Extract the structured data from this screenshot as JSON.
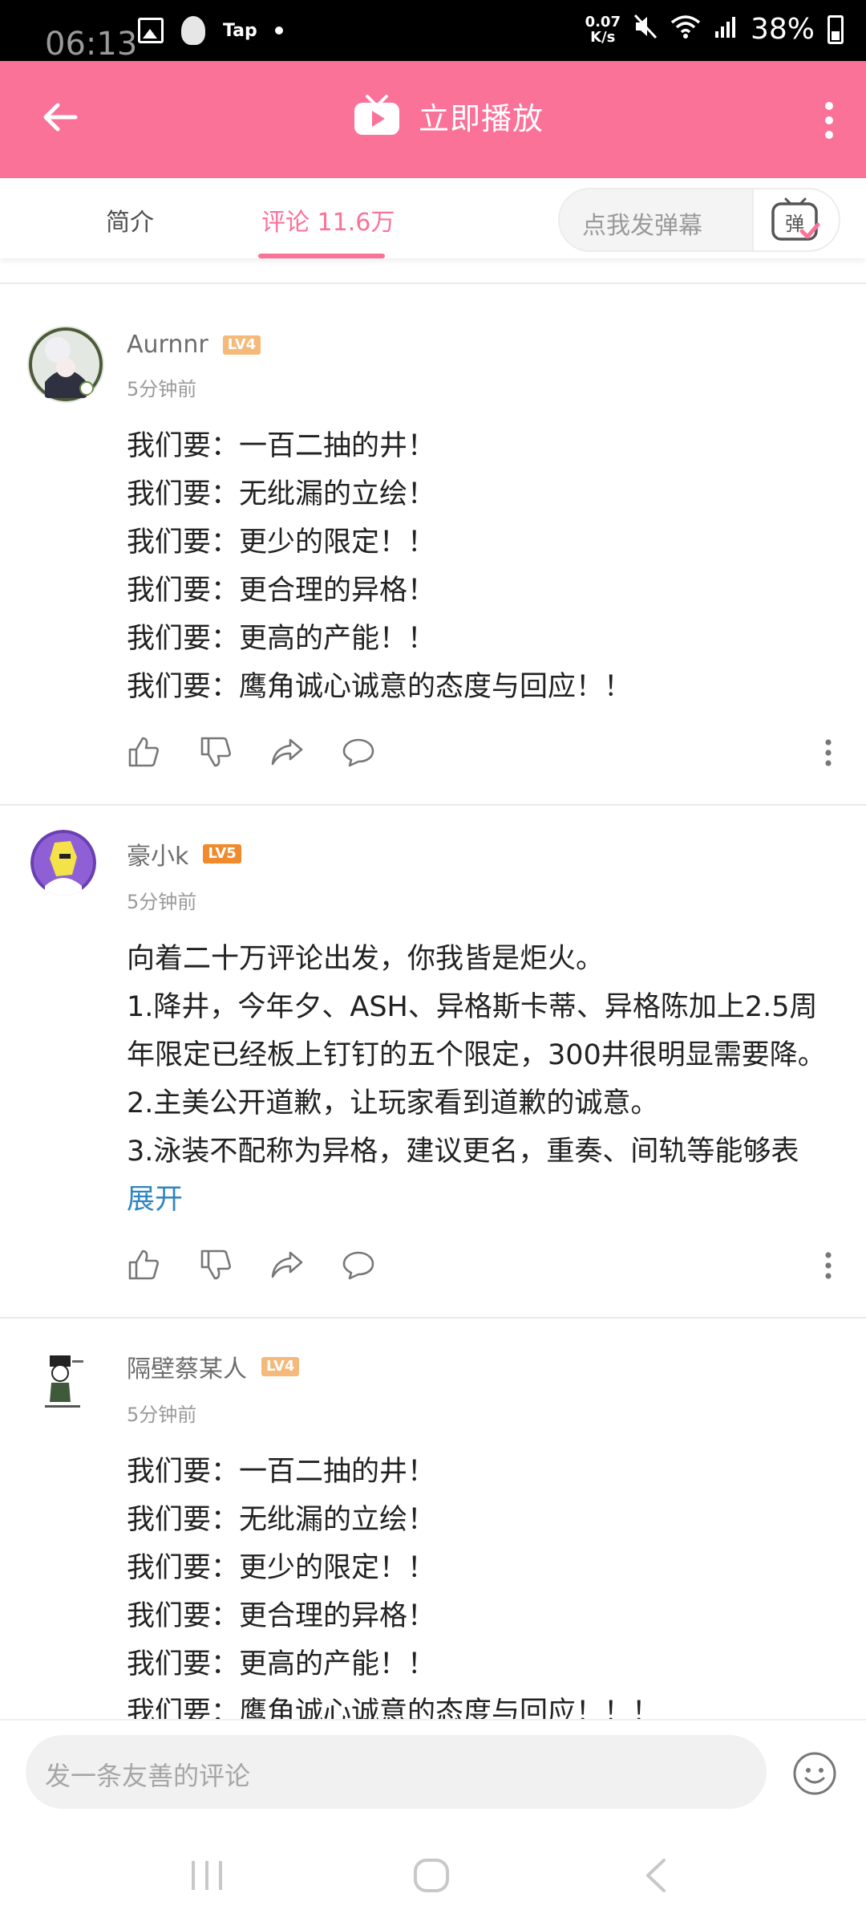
{
  "status_bar": {
    "time": "06:13",
    "tap_label": "Tap",
    "speed_value": "0.07",
    "speed_unit": "K/s",
    "battery": "38%"
  },
  "header": {
    "title": "立即播放",
    "icons": [
      "back-icon",
      "tv-icon",
      "more-vertical-icon"
    ]
  },
  "tabs": {
    "intro": "简介",
    "comments": "评论 11.6万",
    "danmaku_placeholder": "点我发弹幕",
    "danmaku_button": "弹"
  },
  "comments": [
    {
      "username": "Aurnnr",
      "level": "LV4",
      "level_color": "#f5b97a",
      "time": "5分钟前",
      "lines": [
        "我们要：一百二抽的井！",
        "我们要：无纰漏的立绘！",
        "我们要：更少的限定！！",
        "我们要：更合理的异格！",
        "我们要：更高的产能！！",
        "我们要：鹰角诚心诚意的态度与回应！！"
      ]
    },
    {
      "username": "豪小k",
      "level": "LV5",
      "level_color": "#f08a2c",
      "time": "5分钟前",
      "lines": [
        "向着二十万评论出发，你我皆是炬火。",
        "1.降井，今年夕、ASH、异格斯卡蒂、异格陈加上2.5周年限定已经板上钉钉的五个限定，300井很明显需要降。",
        "2.主美公开道歉，让玩家看到道歉的诚意。",
        "3.泳装不配称为异格，建议更名，重奏、间轨等能够表"
      ],
      "expand": "展开"
    },
    {
      "username": "隔壁蔡某人",
      "level": "LV4",
      "level_color": "#f5b97a",
      "time": "5分钟前",
      "lines": [
        "我们要：一百二抽的井！",
        "我们要：无纰漏的立绘！",
        "我们要：更少的限定！！",
        "我们要：更合理的异格！",
        "我们要：更高的产能！！",
        "我们要：鹰角诚心诚意的态度与回应！！！"
      ]
    }
  ],
  "comment_box": {
    "placeholder": "发一条友善的评论"
  },
  "colors": {
    "brand_pink": "#fb7299",
    "link_blue": "#2e86c1"
  }
}
